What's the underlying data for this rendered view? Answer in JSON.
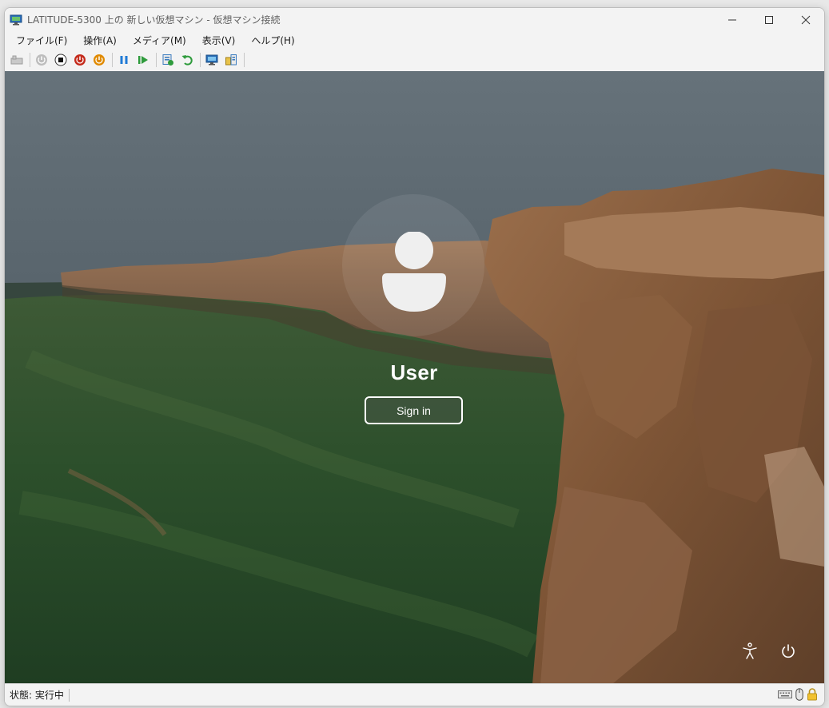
{
  "window": {
    "title": "LATITUDE-5300 上の 新しい仮想マシン - 仮想マシン接続",
    "controls": [
      "minimize-icon",
      "maximize-icon",
      "close-icon"
    ]
  },
  "menu": {
    "items": [
      "ファイル(F)",
      "操作(A)",
      "メディア(M)",
      "表示(V)",
      "ヘルプ(H)"
    ]
  },
  "toolbar": {
    "buttons": [
      "ctrl-alt-del-icon",
      "start-icon",
      "turn-off-icon",
      "shutdown-icon",
      "save-icon",
      "pause-icon",
      "resume-icon",
      "checkpoint-icon",
      "revert-icon",
      "enhanced-session-icon",
      "share-icon"
    ]
  },
  "lockscreen": {
    "user_name": "User",
    "signin_label": "Sign in",
    "corner_icons": [
      "accessibility-icon",
      "power-icon"
    ]
  },
  "status": {
    "text": "状態: 実行中",
    "icons": [
      "keyboard-icon",
      "mouse-icon",
      "lock-icon"
    ]
  },
  "colors": {
    "chrome_bg": "#f3f3f3",
    "accent_green": "#2e9b3c",
    "accent_blue": "#1f7ad6",
    "stop_red": "#c42b1c",
    "save_orange": "#e08a00"
  }
}
